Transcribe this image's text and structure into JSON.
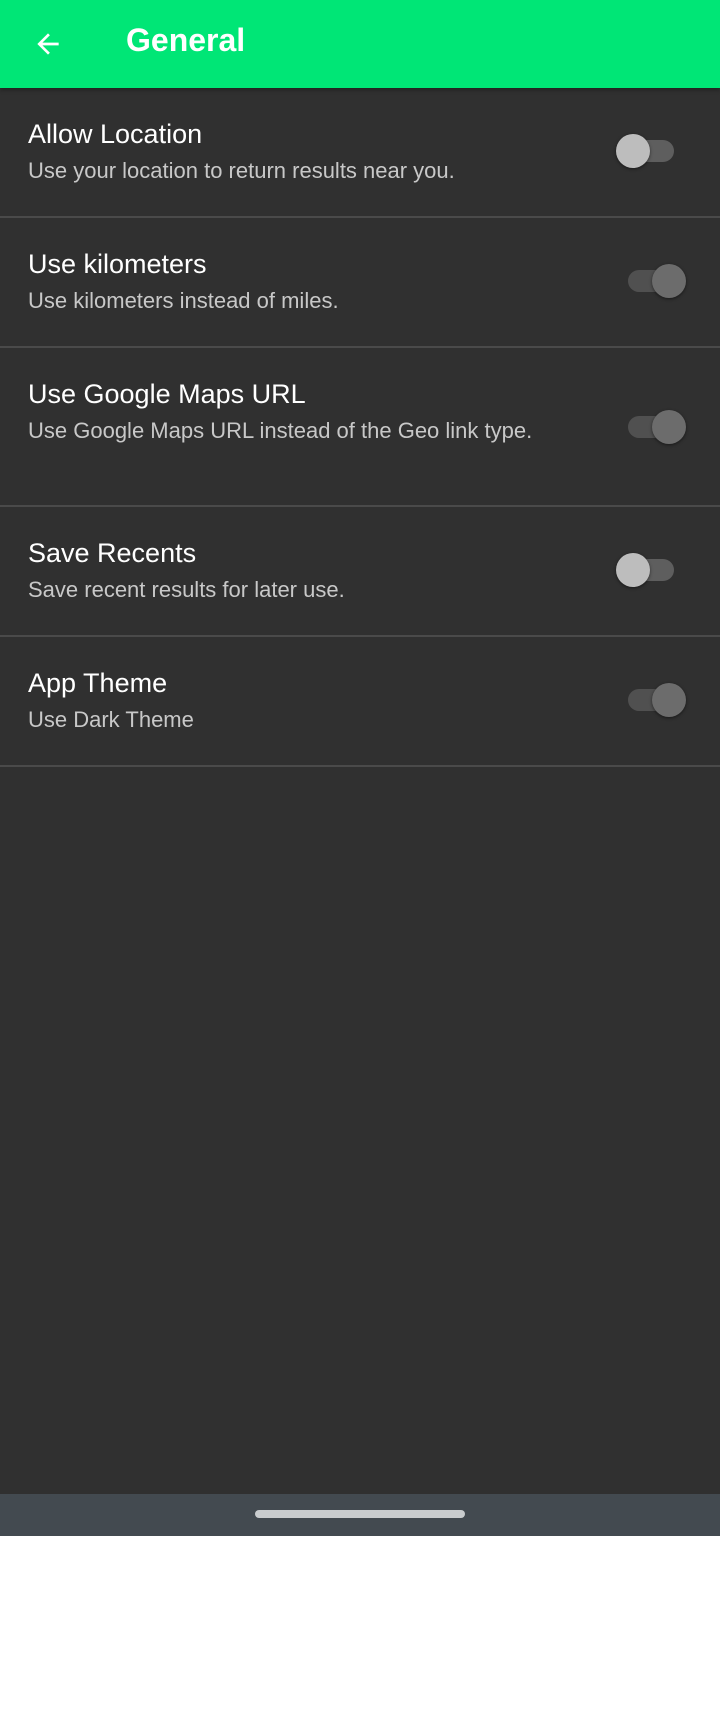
{
  "toolbar": {
    "title": "General",
    "back_icon": "arrow-left-icon",
    "color": "#00e676"
  },
  "preferences": [
    {
      "title": "Allow Location",
      "summary": "Use your location to return results near you.",
      "enabled": false
    },
    {
      "title": "Use kilometers",
      "summary": "Use kilometers instead of miles.",
      "enabled": true
    },
    {
      "title": "Use Google Maps URL",
      "summary": "Use Google Maps URL instead of the Geo link type.",
      "enabled": true
    },
    {
      "title": "Save Recents",
      "summary": "Save recent results for later use.",
      "enabled": false
    },
    {
      "title": "App Theme",
      "summary": "Use Dark Theme",
      "enabled": true
    }
  ],
  "colors": {
    "background": "#303030",
    "divider": "#4a4a4a",
    "nav_bar": "#434a50"
  }
}
